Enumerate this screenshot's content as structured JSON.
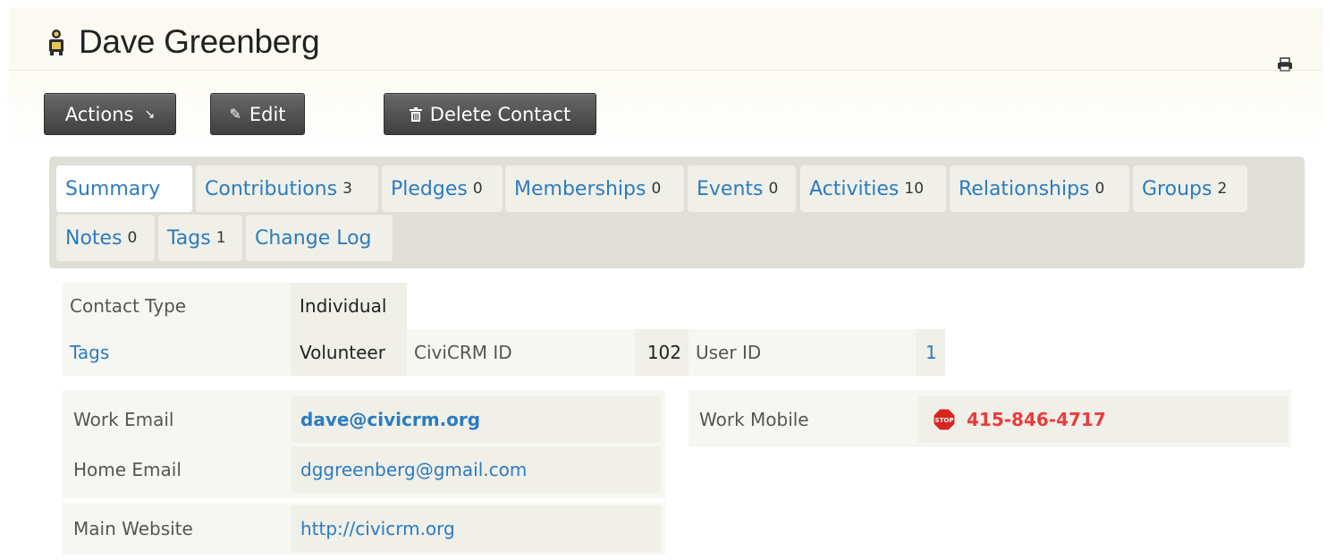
{
  "contact": {
    "name": "Dave Greenberg"
  },
  "toolbar": {
    "actions_label": "Actions",
    "edit_label": "Edit",
    "delete_label": "Delete Contact"
  },
  "tabs": [
    {
      "label": "Summary",
      "count": ""
    },
    {
      "label": "Contributions",
      "count": "3"
    },
    {
      "label": "Pledges",
      "count": "0"
    },
    {
      "label": "Memberships",
      "count": "0"
    },
    {
      "label": "Events",
      "count": "0"
    },
    {
      "label": "Activities",
      "count": "10"
    },
    {
      "label": "Relationships",
      "count": "0"
    },
    {
      "label": "Groups",
      "count": "2"
    },
    {
      "label": "Notes",
      "count": "0"
    },
    {
      "label": "Tags",
      "count": "1"
    },
    {
      "label": "Change Log",
      "count": ""
    }
  ],
  "summary": {
    "contact_type_label": "Contact Type",
    "contact_type_value": "Individual",
    "tags_label": "Tags",
    "tags_value": "Volunteer",
    "civicrm_id_label": "CiviCRM ID",
    "civicrm_id_value": "102",
    "user_id_label": "User ID",
    "user_id_value": "1"
  },
  "communication": {
    "work_email_label": "Work Email",
    "work_email_value": "dave@civicrm.org",
    "home_email_label": "Home Email",
    "home_email_value": "dggreenberg@gmail.com",
    "work_mobile_label": "Work Mobile",
    "work_mobile_value": "415-846-4717",
    "website_label": "Main Website",
    "website_value": "http://civicrm.org"
  },
  "icons": {
    "contact": "contact-person-icon",
    "print": "print-icon",
    "edit": "pencil-icon",
    "delete": "trash-icon",
    "actions_arrow": "arrow-down-right-icon",
    "do_not_call": "stop-sign-icon"
  },
  "colors": {
    "link": "#2a7cc0",
    "phone": "#ec3b3b",
    "button": "#4a4a4a",
    "tab_panel": "#e0dfd7"
  }
}
